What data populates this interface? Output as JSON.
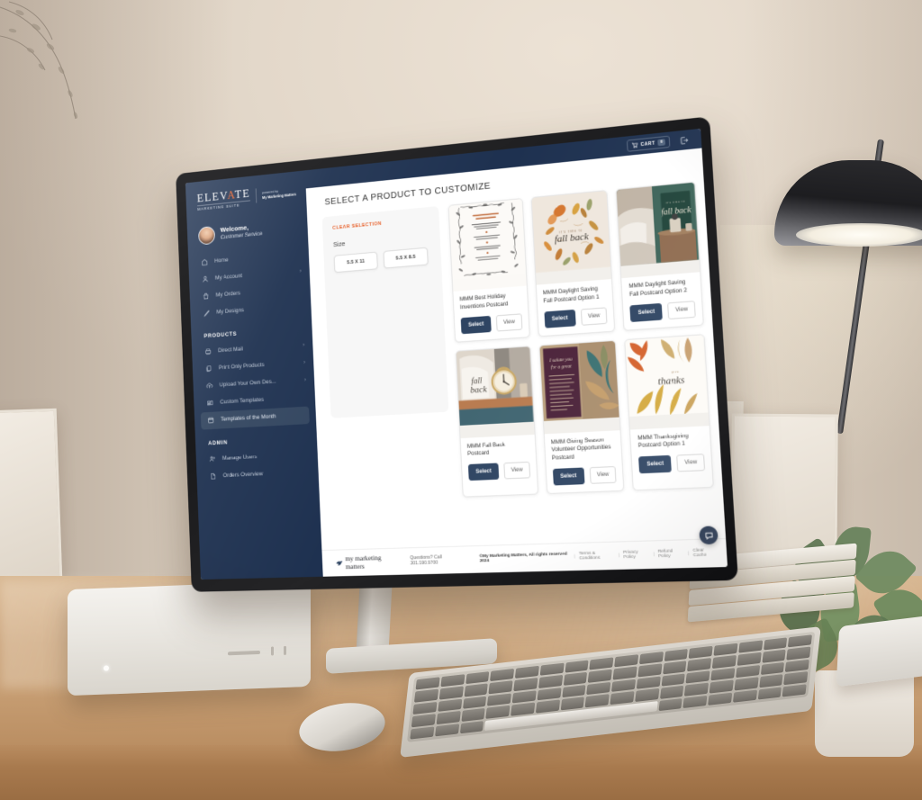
{
  "brand": {
    "logo_primary": "ELEV",
    "logo_accent": "A",
    "logo_primary_end": "TE",
    "logo_subtitle": "MARKETING SUITE",
    "powered_by_label": "powered by",
    "powered_by_name": "My Marketing Matters",
    "accent_color": "#e8622c",
    "navy_color": "#1e3150"
  },
  "user": {
    "greeting": "Welcome,",
    "name": "Customer Service"
  },
  "topbar": {
    "cart_label": "CART",
    "cart_count": "0"
  },
  "sidebar": {
    "items": [
      {
        "label": "Home",
        "icon": "home-icon",
        "chevron": ""
      },
      {
        "label": "My Account",
        "icon": "user-icon",
        "chevron": "›"
      },
      {
        "label": "My Orders",
        "icon": "bag-icon",
        "chevron": ""
      },
      {
        "label": "My Designs",
        "icon": "pencil-icon",
        "chevron": ""
      }
    ],
    "products_heading": "PRODUCTS",
    "product_items": [
      {
        "label": "Direct Mail",
        "icon": "mail-printer-icon",
        "chevron": "›",
        "active": false
      },
      {
        "label": "Print Only Products",
        "icon": "copy-icon",
        "chevron": "›",
        "active": false
      },
      {
        "label": "Upload Your Own Des...",
        "icon": "upload-icon",
        "chevron": "›",
        "active": false
      },
      {
        "label": "Custom Templates",
        "icon": "templates-icon",
        "chevron": "",
        "active": false
      },
      {
        "label": "Templates of the Month",
        "icon": "calendar-icon",
        "chevron": "",
        "active": true
      }
    ],
    "admin_heading": "ADMIN",
    "admin_items": [
      {
        "label": "Manage Users",
        "icon": "manage-users-icon"
      },
      {
        "label": "Orders Overview",
        "icon": "document-icon"
      }
    ]
  },
  "page": {
    "title": "SELECT A PRODUCT TO CUSTOMIZE"
  },
  "filters": {
    "clear_label": "CLEAR SELECTION",
    "size_label": "Size",
    "size_options": [
      "5.5 X 11",
      "5.5 X 8.5"
    ]
  },
  "products": {
    "select_label": "Select",
    "view_label": "View",
    "items": [
      {
        "title": "MMM Best Holiday Inventions Postcard",
        "art": "holiday-inventions"
      },
      {
        "title": "MMM Daylight Saving Fall Postcard Option 1",
        "art": "fall-back-leaves"
      },
      {
        "title": "MMM Daylight Saving Fall Postcard Option 2",
        "art": "fall-back-room"
      },
      {
        "title": "MMM Fall Back Postcard",
        "art": "fall-back-clock"
      },
      {
        "title": "MMM Giving Season Volunteer Opportunities Postcard",
        "art": "giving-season"
      },
      {
        "title": "MMM Thanksgiving Postcard Option 1",
        "art": "thanksgiving"
      }
    ]
  },
  "footer": {
    "logo_text": "my marketing matters",
    "phone": "Questions? Call 301.590.9700",
    "copyright": "©My Marketing Matters, All rights reserved 2024",
    "links": [
      "Terms & Conditions",
      "Privacy Policy",
      "Refund Policy",
      "Clear Cache"
    ]
  }
}
